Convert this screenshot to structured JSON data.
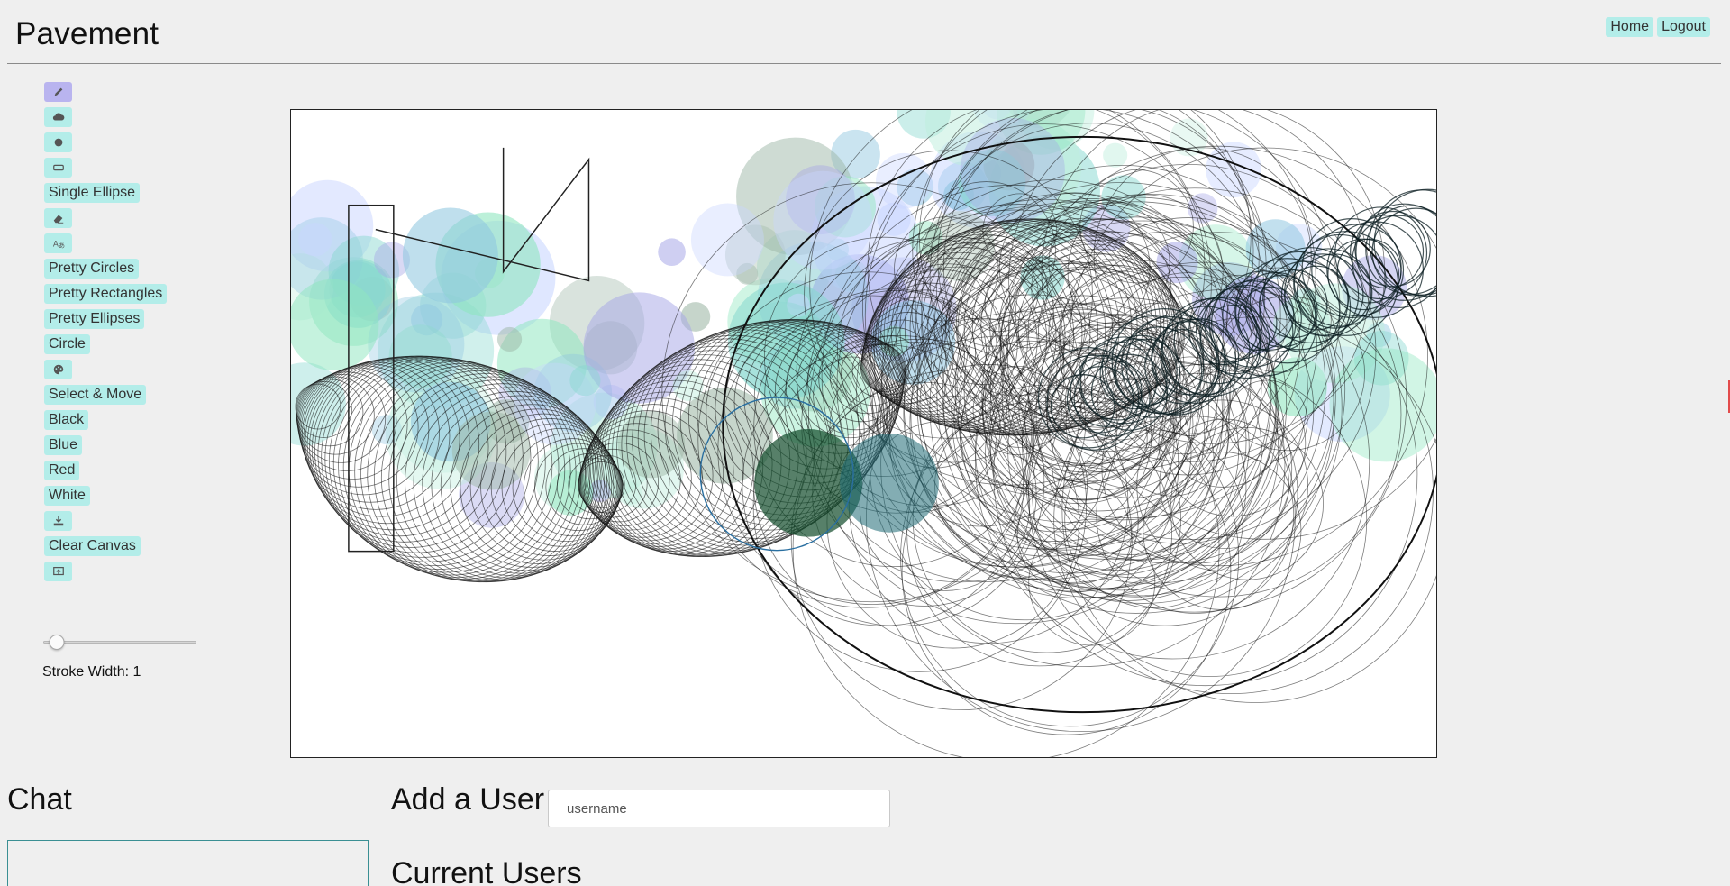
{
  "header": {
    "title": "Pavement",
    "nav": [
      {
        "label": "Home"
      },
      {
        "label": "Logout"
      }
    ]
  },
  "toolbar": {
    "items": [
      {
        "type": "icon",
        "icon": "pencil-icon",
        "name": "pencil-tool-button",
        "active": true
      },
      {
        "type": "icon",
        "icon": "cloud-icon",
        "name": "cloud-tool-button"
      },
      {
        "type": "icon",
        "icon": "circle-dot-icon",
        "name": "dot-tool-button"
      },
      {
        "type": "icon",
        "icon": "rectangle-icon",
        "name": "rectangle-tool-button"
      },
      {
        "type": "text",
        "label": "Single Ellipse",
        "name": "single-ellipse-button"
      },
      {
        "type": "icon",
        "icon": "eraser-icon",
        "name": "eraser-tool-button"
      },
      {
        "type": "icon",
        "icon": "text-language-icon",
        "name": "text-tool-button"
      },
      {
        "type": "text",
        "label": "Pretty Circles",
        "name": "pretty-circles-button"
      },
      {
        "type": "text",
        "label": "Pretty Rectangles",
        "name": "pretty-rectangles-button"
      },
      {
        "type": "text",
        "label": "Pretty Ellipses",
        "name": "pretty-ellipses-button"
      },
      {
        "type": "text",
        "label": "Circle",
        "name": "circle-button"
      },
      {
        "type": "icon",
        "icon": "palette-icon",
        "name": "palette-button"
      },
      {
        "type": "text",
        "label": "Select & Move",
        "name": "select-move-button"
      },
      {
        "type": "text",
        "label": "Black",
        "name": "color-black-button"
      },
      {
        "type": "text",
        "label": "Blue",
        "name": "color-blue-button"
      },
      {
        "type": "text",
        "label": "Red",
        "name": "color-red-button"
      },
      {
        "type": "text",
        "label": "White",
        "name": "color-white-button"
      },
      {
        "type": "icon",
        "icon": "download-icon",
        "name": "download-button"
      },
      {
        "type": "text",
        "label": "Clear Canvas",
        "name": "clear-canvas-button"
      },
      {
        "type": "icon",
        "icon": "upload-screen-icon",
        "name": "upload-button"
      }
    ]
  },
  "stroke": {
    "label": "Stroke Width: 1",
    "value": 1,
    "min": 0,
    "max": 10
  },
  "chat": {
    "title": "Chat"
  },
  "users": {
    "add_title": "Add a User",
    "input_placeholder": "username",
    "current_title": "Current Users"
  },
  "colors": {
    "accent": "#b3ede9",
    "active": "#b9b4ef",
    "background": "#efefef"
  }
}
